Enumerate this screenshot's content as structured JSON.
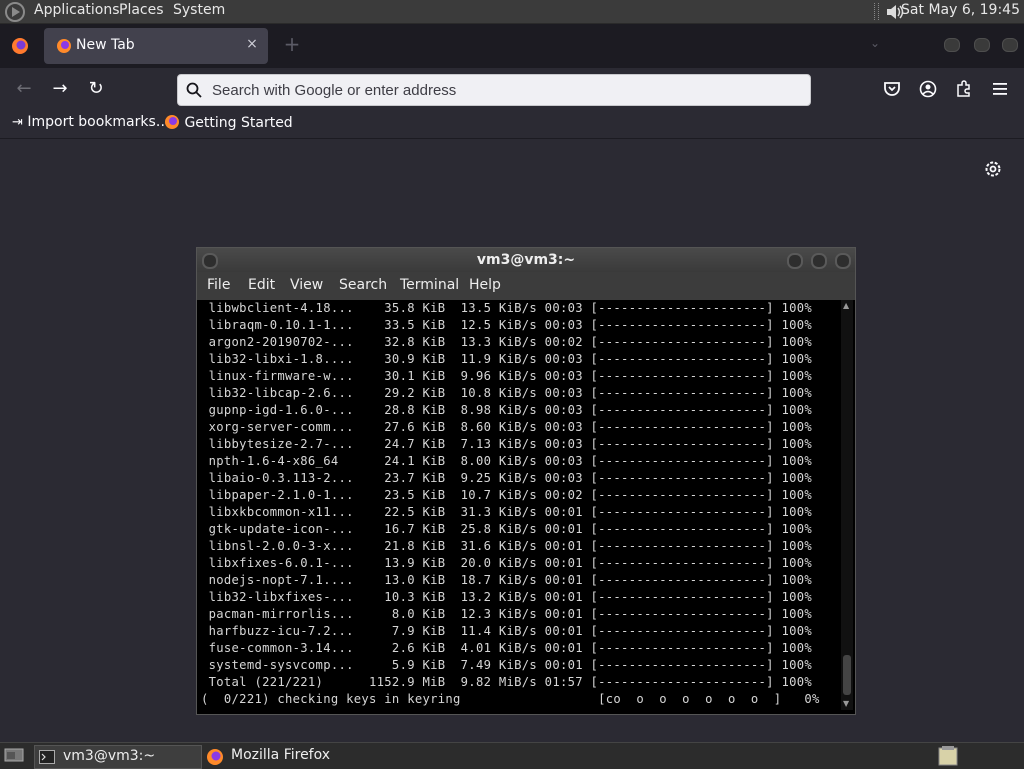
{
  "top_panel": {
    "menus": [
      "Applications",
      "Places",
      "System"
    ],
    "clock": "Sat May  6, 19:45"
  },
  "browser": {
    "tab_title": "New Tab",
    "tab_close": "×",
    "new_tab": "+",
    "tab_list": "⌄",
    "search_placeholder": "Search with Google or enter address",
    "bookmarks": [
      "Import bookmarks…",
      "Getting Started"
    ]
  },
  "terminal": {
    "title": "vm3@vm3:~",
    "menus": [
      "File",
      "Edit",
      "View",
      "Search",
      "Terminal",
      "Help"
    ],
    "lines": [
      " libwbclient-4.18...    35.8 KiB  13.5 KiB/s 00:03 [----------------------] 100%",
      " libraqm-0.10.1-1...    33.5 KiB  12.5 KiB/s 00:03 [----------------------] 100%",
      " argon2-20190702-...    32.8 KiB  13.3 KiB/s 00:02 [----------------------] 100%",
      " lib32-libxi-1.8....    30.9 KiB  11.9 KiB/s 00:03 [----------------------] 100%",
      " linux-firmware-w...    30.1 KiB  9.96 KiB/s 00:03 [----------------------] 100%",
      " lib32-libcap-2.6...    29.2 KiB  10.8 KiB/s 00:03 [----------------------] 100%",
      " gupnp-igd-1.6.0-...    28.8 KiB  8.98 KiB/s 00:03 [----------------------] 100%",
      " xorg-server-comm...    27.6 KiB  8.60 KiB/s 00:03 [----------------------] 100%",
      " libbytesize-2.7-...    24.7 KiB  7.13 KiB/s 00:03 [----------------------] 100%",
      " npth-1.6-4-x86_64      24.1 KiB  8.00 KiB/s 00:03 [----------------------] 100%",
      " libaio-0.3.113-2...    23.7 KiB  9.25 KiB/s 00:03 [----------------------] 100%",
      " libpaper-2.1.0-1...    23.5 KiB  10.7 KiB/s 00:02 [----------------------] 100%",
      " libxkbcommon-x11...    22.5 KiB  31.3 KiB/s 00:01 [----------------------] 100%",
      " gtk-update-icon-...    16.7 KiB  25.8 KiB/s 00:01 [----------------------] 100%",
      " libnsl-2.0.0-3-x...    21.8 KiB  31.6 KiB/s 00:01 [----------------------] 100%",
      " libxfixes-6.0.1-...    13.9 KiB  20.0 KiB/s 00:01 [----------------------] 100%",
      " nodejs-nopt-7.1....    13.0 KiB  18.7 KiB/s 00:01 [----------------------] 100%",
      " lib32-libxfixes-...    10.3 KiB  13.2 KiB/s 00:01 [----------------------] 100%",
      " pacman-mirrorlis...     8.0 KiB  12.3 KiB/s 00:01 [----------------------] 100%",
      " harfbuzz-icu-7.2...     7.9 KiB  11.4 KiB/s 00:01 [----------------------] 100%",
      " fuse-common-3.14...     2.6 KiB  4.01 KiB/s 00:01 [----------------------] 100%",
      " systemd-sysvcomp...     5.9 KiB  7.49 KiB/s 00:01 [----------------------] 100%",
      " Total (221/221)      1152.9 MiB  9.82 MiB/s 01:57 [----------------------] 100%",
      "(  0/221) checking keys in keyring                  [co  o  o  o  o  o  o  ]   0%"
    ]
  },
  "taskbar": {
    "items": [
      "vm3@vm3:~",
      "Mozilla Firefox"
    ]
  }
}
